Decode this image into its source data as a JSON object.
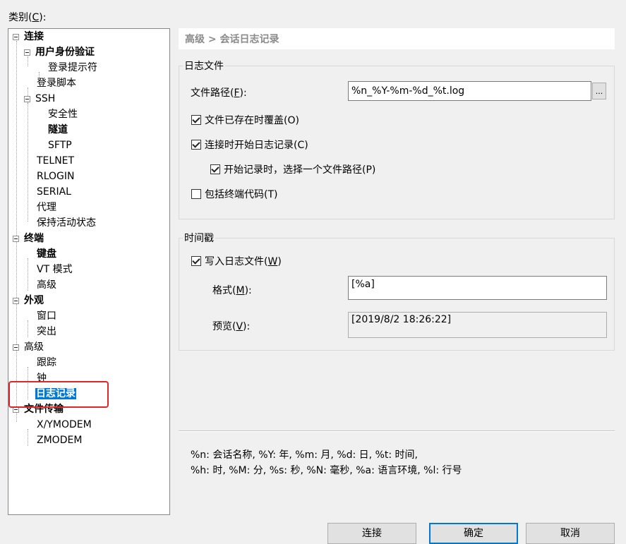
{
  "category_label": "类别(C):",
  "tree": [
    {
      "label": "连接",
      "bold": true
    },
    {
      "label": "用户身份验证",
      "bold": true
    },
    {
      "label": "登录提示符"
    },
    {
      "label": "登录脚本"
    },
    {
      "label": "SSH"
    },
    {
      "label": "安全性"
    },
    {
      "label": "隧道",
      "bold": true
    },
    {
      "label": "SFTP"
    },
    {
      "label": "TELNET"
    },
    {
      "label": "RLOGIN"
    },
    {
      "label": "SERIAL"
    },
    {
      "label": "代理"
    },
    {
      "label": "保持活动状态"
    },
    {
      "label": "终端",
      "bold": true
    },
    {
      "label": "键盘",
      "bold": true
    },
    {
      "label": "VT 模式"
    },
    {
      "label": "高级"
    },
    {
      "label": "外观",
      "bold": true
    },
    {
      "label": "窗口"
    },
    {
      "label": "突出"
    },
    {
      "label": "高级"
    },
    {
      "label": "跟踪"
    },
    {
      "label": "钟"
    },
    {
      "label": "日志记录",
      "bold": true,
      "selected": true
    },
    {
      "label": "文件传输",
      "bold": true
    },
    {
      "label": "X/YMODEM"
    },
    {
      "label": "ZMODEM"
    }
  ],
  "breadcrumb": "高级 > 会话日志记录",
  "log_file": {
    "group_title": "日志文件",
    "path_label": "文件路径",
    "path_key": "F",
    "path_value": "%n_%Y-%m-%d_%t.log",
    "browse_label": "...",
    "overwrite_label": "文件已存在时覆盖(O)",
    "overwrite_checked": true,
    "start_on_connect_label": "连接时开始日志记录(C)",
    "start_on_connect_checked": true,
    "choose_path_label": "开始记录时，选择一个文件路径(P)",
    "choose_path_checked": true,
    "include_terminal_label": "包括终端代码(T)",
    "include_terminal_checked": false
  },
  "timestamp": {
    "group_title": "时间戳",
    "write_label": "写入日志文件",
    "write_key": "W",
    "write_checked": true,
    "format_label": "格式",
    "format_key": "M",
    "format_value": "[%a]",
    "preview_label": "预览",
    "preview_key": "V",
    "preview_value": "[2019/8/2 18:26:22]"
  },
  "help": {
    "line1": "%n: 会话名称, %Y: 年, %m: 月, %d: 日, %t: 时间,",
    "line2": " %h: 时, %M: 分, %s: 秒, %N: 毫秒, %a: 语言环境, %l: 行号"
  },
  "buttons": {
    "connect": "连接",
    "ok": "确定",
    "cancel": "取消"
  }
}
